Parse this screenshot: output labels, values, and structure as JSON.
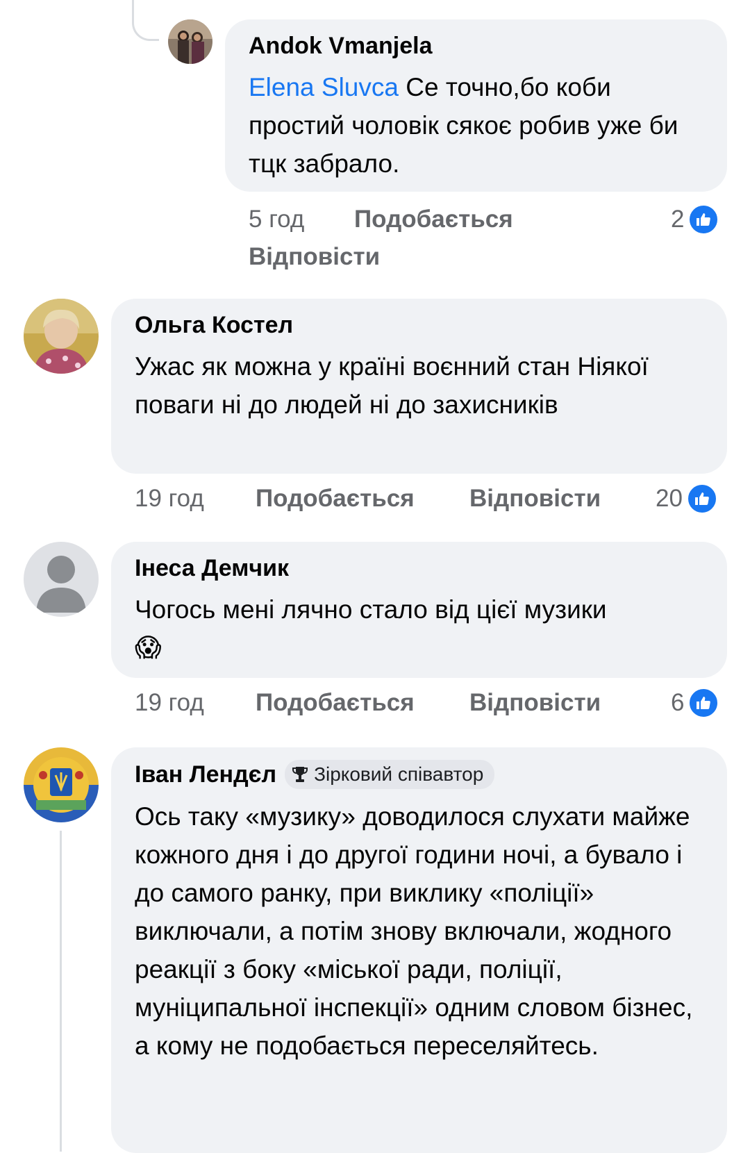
{
  "comments": [
    {
      "author": "Andok Vmanjela",
      "mention": "Elena Sluvca",
      "text": " Се точно,бо коби простий чоловік сякоє робив уже би тцк забрало.",
      "time": "5 год",
      "like_label": "Подобається",
      "reply_label": "Відповісти",
      "likes": "2"
    },
    {
      "author": "Ольга Костел",
      "text": "Ужас як можна у країні воєнний стан Ніякої поваги ні до людей ні до захисників",
      "time": "19 год",
      "like_label": "Подобається",
      "reply_label": "Відповісти",
      "likes": "20"
    },
    {
      "author": "Інеса Демчик",
      "text": "Чогось мені лячно стало від цієї музики 😱",
      "time": "19 год",
      "like_label": "Подобається",
      "reply_label": "Відповісти",
      "likes": "6"
    },
    {
      "author": "Іван Лендєл",
      "badge": "Зірковий співавтор",
      "text": "Ось таку «музику» доводилося слухати майже кожного дня і до другої години ночі, а бувало і до самого ранку, при виклику «поліції» виключали, а потім знову включали, жодного реакції з боку «міської ради, поліції, муніципальної інспекції» одним словом бізнес, а кому не подобається переселяйтесь."
    }
  ],
  "icons": {
    "like": "thumbs-up-icon",
    "badge": "trophy-icon",
    "default_avatar": "person-silhouette-icon"
  },
  "colors": {
    "bubble": "#f0f2f5",
    "mention": "#1877f2",
    "like_badge": "#1877f2",
    "meta_text": "#65676b"
  }
}
